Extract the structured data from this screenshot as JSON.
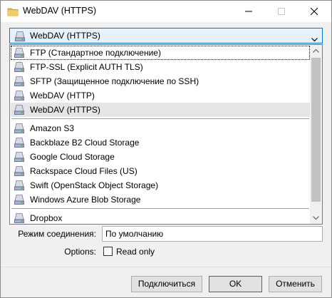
{
  "window": {
    "title": "WebDAV (HTTPS)"
  },
  "protocol": {
    "selected": "WebDAV (HTTPS)",
    "groups": [
      [
        "FTP (Стандартное подключение)",
        "FTP-SSL (Explicit AUTH TLS)",
        "SFTP (Защищенное подключение по SSH)",
        "WebDAV (HTTP)",
        "WebDAV (HTTPS)"
      ],
      [
        "Amazon S3",
        "Backblaze B2 Cloud Storage",
        "Google Cloud Storage",
        "Rackspace Cloud Files (US)",
        "Swift (OpenStack Object Storage)",
        "Windows Azure Blob Storage"
      ],
      [
        "Dropbox"
      ]
    ],
    "highlighted": "WebDAV (HTTPS)",
    "focused": "FTP (Стандартное подключение)"
  },
  "connection_mode": {
    "label": "Режим соединения:",
    "value": "По умолчанию"
  },
  "options": {
    "label": "Options:",
    "read_only_label": "Read only",
    "read_only_checked": false
  },
  "buttons": {
    "connect": "Подключиться",
    "ok": "OK",
    "cancel": "Отменить"
  },
  "icons": {
    "protocol": "drive-icon",
    "app": "folder-icon"
  }
}
